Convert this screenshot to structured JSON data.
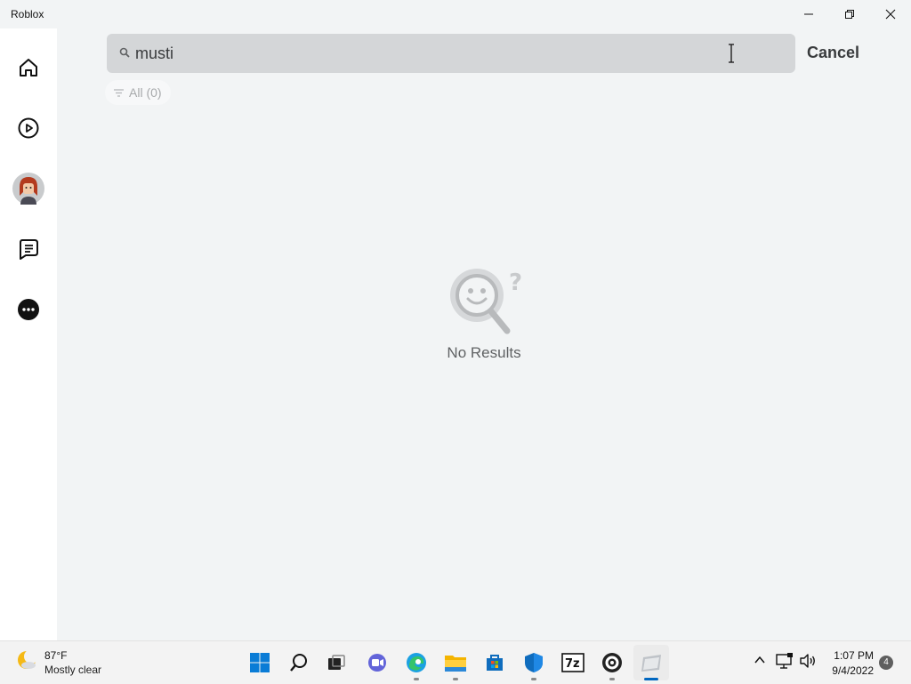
{
  "window": {
    "title": "Roblox",
    "controls": [
      "minimize-icon",
      "restore-icon",
      "close-icon"
    ]
  },
  "sidebar": {
    "items": [
      {
        "name": "home",
        "icon": "home-icon"
      },
      {
        "name": "play",
        "icon": "play-icon"
      },
      {
        "name": "avatar",
        "icon": "avatar-icon"
      },
      {
        "name": "chat",
        "icon": "chat-icon"
      },
      {
        "name": "more",
        "icon": "more-icon"
      }
    ]
  },
  "search": {
    "value": "musti",
    "cancel_label": "Cancel"
  },
  "filter": {
    "label": "All (0)"
  },
  "results": {
    "empty_text": "No Results"
  },
  "taskbar": {
    "weather": {
      "temp": "87°F",
      "condition": "Mostly clear"
    },
    "apps": [
      "windows-start",
      "search",
      "task-view",
      "teams-chat",
      "edge",
      "file-explorer",
      "microsoft-store",
      "windows-security",
      "7zip",
      "obs",
      "roblox"
    ],
    "clock": {
      "time": "1:07 PM",
      "date": "9/4/2022"
    },
    "notification_count": "4"
  },
  "colors": {
    "accent": "#0067c0",
    "search_bg": "#d4d6d8",
    "page_bg": "#f2f4f5"
  }
}
